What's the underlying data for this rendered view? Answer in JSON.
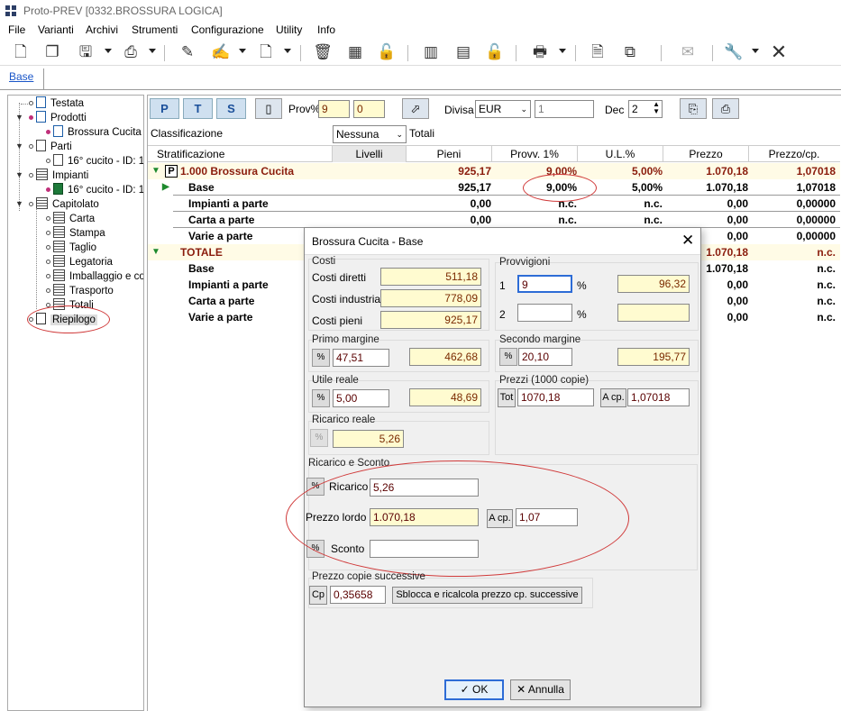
{
  "window": {
    "title": "Proto-PREV   [0332.BROSSURA LOGICA]"
  },
  "menu": [
    "File",
    "Varianti",
    "Archivi",
    "Strumenti",
    "Configurazione",
    "Utility",
    "Info"
  ],
  "tab": {
    "label": "Base"
  },
  "tree": {
    "items": [
      {
        "label": "Testata"
      },
      {
        "label": "Prodotti"
      },
      {
        "label": "Brossura Cucita"
      },
      {
        "label": "Parti"
      },
      {
        "label": "16° cucito - ID: 1"
      },
      {
        "label": "Impianti"
      },
      {
        "label": "16° cucito - ID: 1"
      },
      {
        "label": "Capitolato"
      },
      {
        "label": "Carta"
      },
      {
        "label": "Stampa"
      },
      {
        "label": "Taglio"
      },
      {
        "label": "Legatoria"
      },
      {
        "label": "Imballaggio e co"
      },
      {
        "label": "Trasporto"
      },
      {
        "label": "Totali"
      },
      {
        "label": "Riepilogo"
      }
    ]
  },
  "topbar": {
    "btn_p": "P",
    "btn_t": "T",
    "btn_s": "S",
    "prov_label": "Prov%",
    "prov1": "9",
    "prov2": "0",
    "divisa_label": "Divisa",
    "divisa_value": "EUR",
    "divisa_rate": "1",
    "dec_label": "Dec",
    "dec_value": "2"
  },
  "classif": {
    "label": "Classificazione",
    "value": "Nessuna",
    "totali": "Totali"
  },
  "grid": {
    "headers": [
      "Stratificazione",
      "Livelli",
      "Pieni",
      "Provv. 1%",
      "U.L.%",
      "Prezzo",
      "Prezzo/cp."
    ],
    "rows": [
      {
        "label": "1.000 Brossura Cucita",
        "pieni": "925,17",
        "provv": "9,00%",
        "ul": "5,00%",
        "prezzo": "1.070,18",
        "prezzocp": "1,07018"
      },
      {
        "label": "Base",
        "pieni": "925,17",
        "provv": "9,00%",
        "ul": "5,00%",
        "prezzo": "1.070,18",
        "prezzocp": "1,07018"
      },
      {
        "label": "Impianti a parte",
        "pieni": "0,00",
        "provv": "n.c.",
        "ul": "n.c.",
        "prezzo": "0,00",
        "prezzocp": "0,00000"
      },
      {
        "label": "Carta a parte",
        "pieni": "0,00",
        "provv": "n.c.",
        "ul": "n.c.",
        "prezzo": "0,00",
        "prezzocp": "0,00000"
      },
      {
        "label": "Varie a parte",
        "pieni": "",
        "provv": "",
        "ul": "",
        "prezzo": "0,00",
        "prezzocp": "0,00000"
      },
      {
        "label": "TOTALE",
        "pieni": "",
        "provv": "",
        "ul": "",
        "prezzo": "1.070,18",
        "prezzocp": "n.c."
      },
      {
        "label": "Base",
        "pieni": "",
        "provv": "",
        "ul": "",
        "prezzo": "1.070,18",
        "prezzocp": "n.c."
      },
      {
        "label": "Impianti a parte",
        "pieni": "",
        "provv": "",
        "ul": "",
        "prezzo": "0,00",
        "prezzocp": "n.c."
      },
      {
        "label": "Carta a parte",
        "pieni": "",
        "provv": "",
        "ul": "",
        "prezzo": "0,00",
        "prezzocp": "n.c."
      },
      {
        "label": "Varie a parte",
        "pieni": "",
        "provv": "",
        "ul": "",
        "prezzo": "0,00",
        "prezzocp": "n.c."
      }
    ]
  },
  "dialog": {
    "title": "Brossura Cucita - Base",
    "costi": {
      "title": "Costi",
      "diretti_label": "Costi diretti",
      "diretti": "511,18",
      "industriali_label": "Costi industriali",
      "industriali": "778,09",
      "pieni_label": "Costi pieni",
      "pieni": "925,17"
    },
    "provvigioni": {
      "title": "Provvigioni",
      "r1_label": "1",
      "r1_pct": "9",
      "r1_sym": "%",
      "r1_val": "96,32",
      "r2_label": "2",
      "r2_pct": "",
      "r2_sym": "%",
      "r2_val": ""
    },
    "primo_margine": {
      "title": "Primo margine",
      "pct": "47,51",
      "val": "462,68"
    },
    "secondo_margine": {
      "title": "Secondo margine",
      "pct": "20,10",
      "val": "195,77"
    },
    "utile_reale": {
      "title": "Utile reale",
      "pct": "5,00",
      "val": "48,69"
    },
    "prezzi": {
      "title": "Prezzi (1000 copie)",
      "tot_label": "Tot",
      "tot": "1070,18",
      "acp_label": "A cp.",
      "acp": "1,07018"
    },
    "ricarico_reale": {
      "title": "Ricarico reale",
      "val": "5,26"
    },
    "ricarico_sconto": {
      "title": "Ricarico e Sconto",
      "ricarico_label": "Ricarico",
      "ricarico": "5,26",
      "prezzo_lordo_label": "Prezzo lordo",
      "prezzo_lordo": "1.070,18",
      "acp_label": "A cp.",
      "acp": "1,07",
      "sconto_label": "Sconto",
      "sconto": ""
    },
    "copie_succ": {
      "title": "Prezzo copie successive",
      "cp_label": "Cp",
      "cp": "0,35658",
      "sblocca": "Sblocca e ricalcola prezzo cp. successive"
    },
    "ok": "OK",
    "annulla": "Annulla",
    "pct_symbol": "%"
  }
}
